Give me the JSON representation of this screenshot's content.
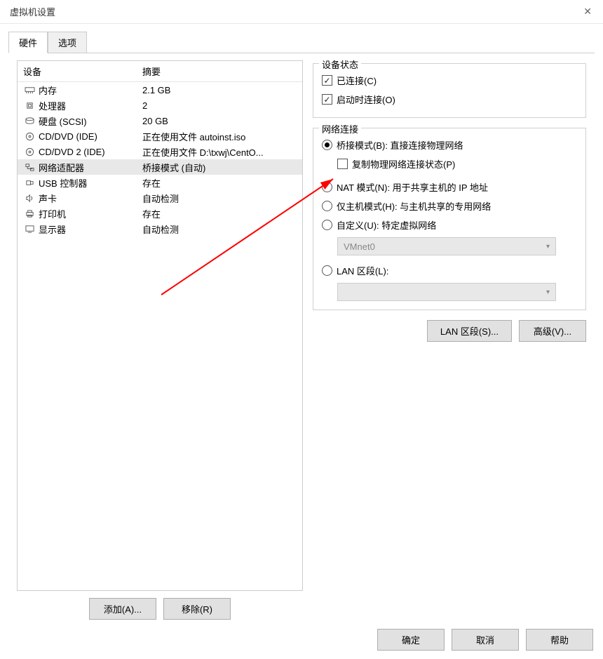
{
  "window": {
    "title": "虚拟机设置"
  },
  "tabs": {
    "hardware": "硬件",
    "options": "选项"
  },
  "table": {
    "device_header": "设备",
    "summary_header": "摘要"
  },
  "devices": [
    {
      "icon": "memory",
      "name": "内存",
      "summary": "2.1 GB"
    },
    {
      "icon": "cpu",
      "name": "处理器",
      "summary": "2"
    },
    {
      "icon": "disk",
      "name": "硬盘 (SCSI)",
      "summary": "20 GB"
    },
    {
      "icon": "cd",
      "name": "CD/DVD (IDE)",
      "summary": "正在使用文件 autoinst.iso"
    },
    {
      "icon": "cd",
      "name": "CD/DVD 2 (IDE)",
      "summary": "正在使用文件 D:\\txwj\\CentO..."
    },
    {
      "icon": "net",
      "name": "网络适配器",
      "summary": "桥接模式 (自动)"
    },
    {
      "icon": "usb",
      "name": "USB 控制器",
      "summary": "存在"
    },
    {
      "icon": "sound",
      "name": "声卡",
      "summary": "自动检测"
    },
    {
      "icon": "printer",
      "name": "打印机",
      "summary": "存在"
    },
    {
      "icon": "display",
      "name": "显示器",
      "summary": "自动检测"
    }
  ],
  "actions": {
    "add": "添加(A)...",
    "remove": "移除(R)"
  },
  "status_group": {
    "title": "设备状态",
    "connected": "已连接(C)",
    "connect_at_poweron": "启动时连接(O)"
  },
  "net_group": {
    "title": "网络连接",
    "bridged": "桥接模式(B): 直接连接物理网络",
    "replicate": "复制物理网络连接状态(P)",
    "nat": "NAT 模式(N): 用于共享主机的 IP 地址",
    "hostonly": "仅主机模式(H): 与主机共享的专用网络",
    "custom": "自定义(U): 特定虚拟网络",
    "custom_value": "VMnet0",
    "lan": "LAN 区段(L):",
    "lan_value": ""
  },
  "right_actions": {
    "lan_segments": "LAN 区段(S)...",
    "advanced": "高级(V)..."
  },
  "bottom": {
    "ok": "确定",
    "cancel": "取消",
    "help": "帮助"
  }
}
